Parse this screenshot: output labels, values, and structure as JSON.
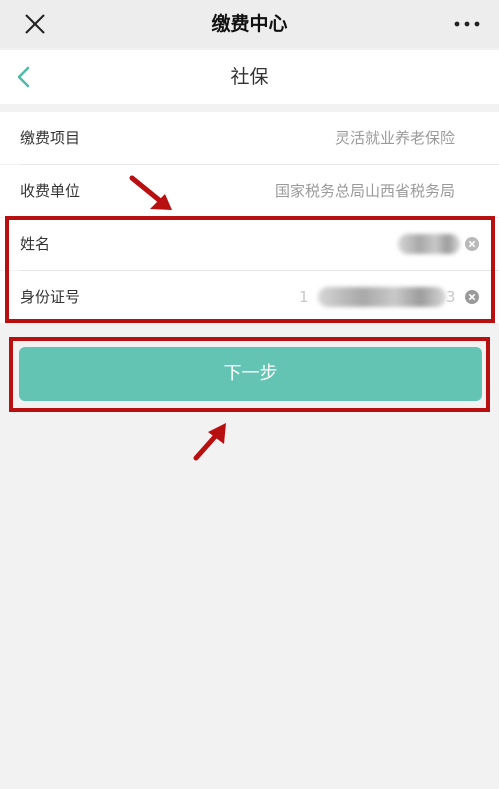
{
  "topbar": {
    "title": "缴费中心",
    "close_icon": "close-icon",
    "more_icon": "more-icon"
  },
  "navbar": {
    "title": "社保",
    "back_icon": "chevron-left-icon"
  },
  "info": {
    "item_label": "缴费项目",
    "item_value": "灵活就业养老保险",
    "unit_label": "收费单位",
    "unit_value": "国家税务总局山西省税务局"
  },
  "form": {
    "name_label": "姓名",
    "id_label": "身份证号",
    "id_prefix": "1",
    "id_suffix": "3"
  },
  "actions": {
    "next_label": "下一步"
  },
  "colors": {
    "accent": "#64c4b4",
    "annotation_red": "#b80f10"
  }
}
